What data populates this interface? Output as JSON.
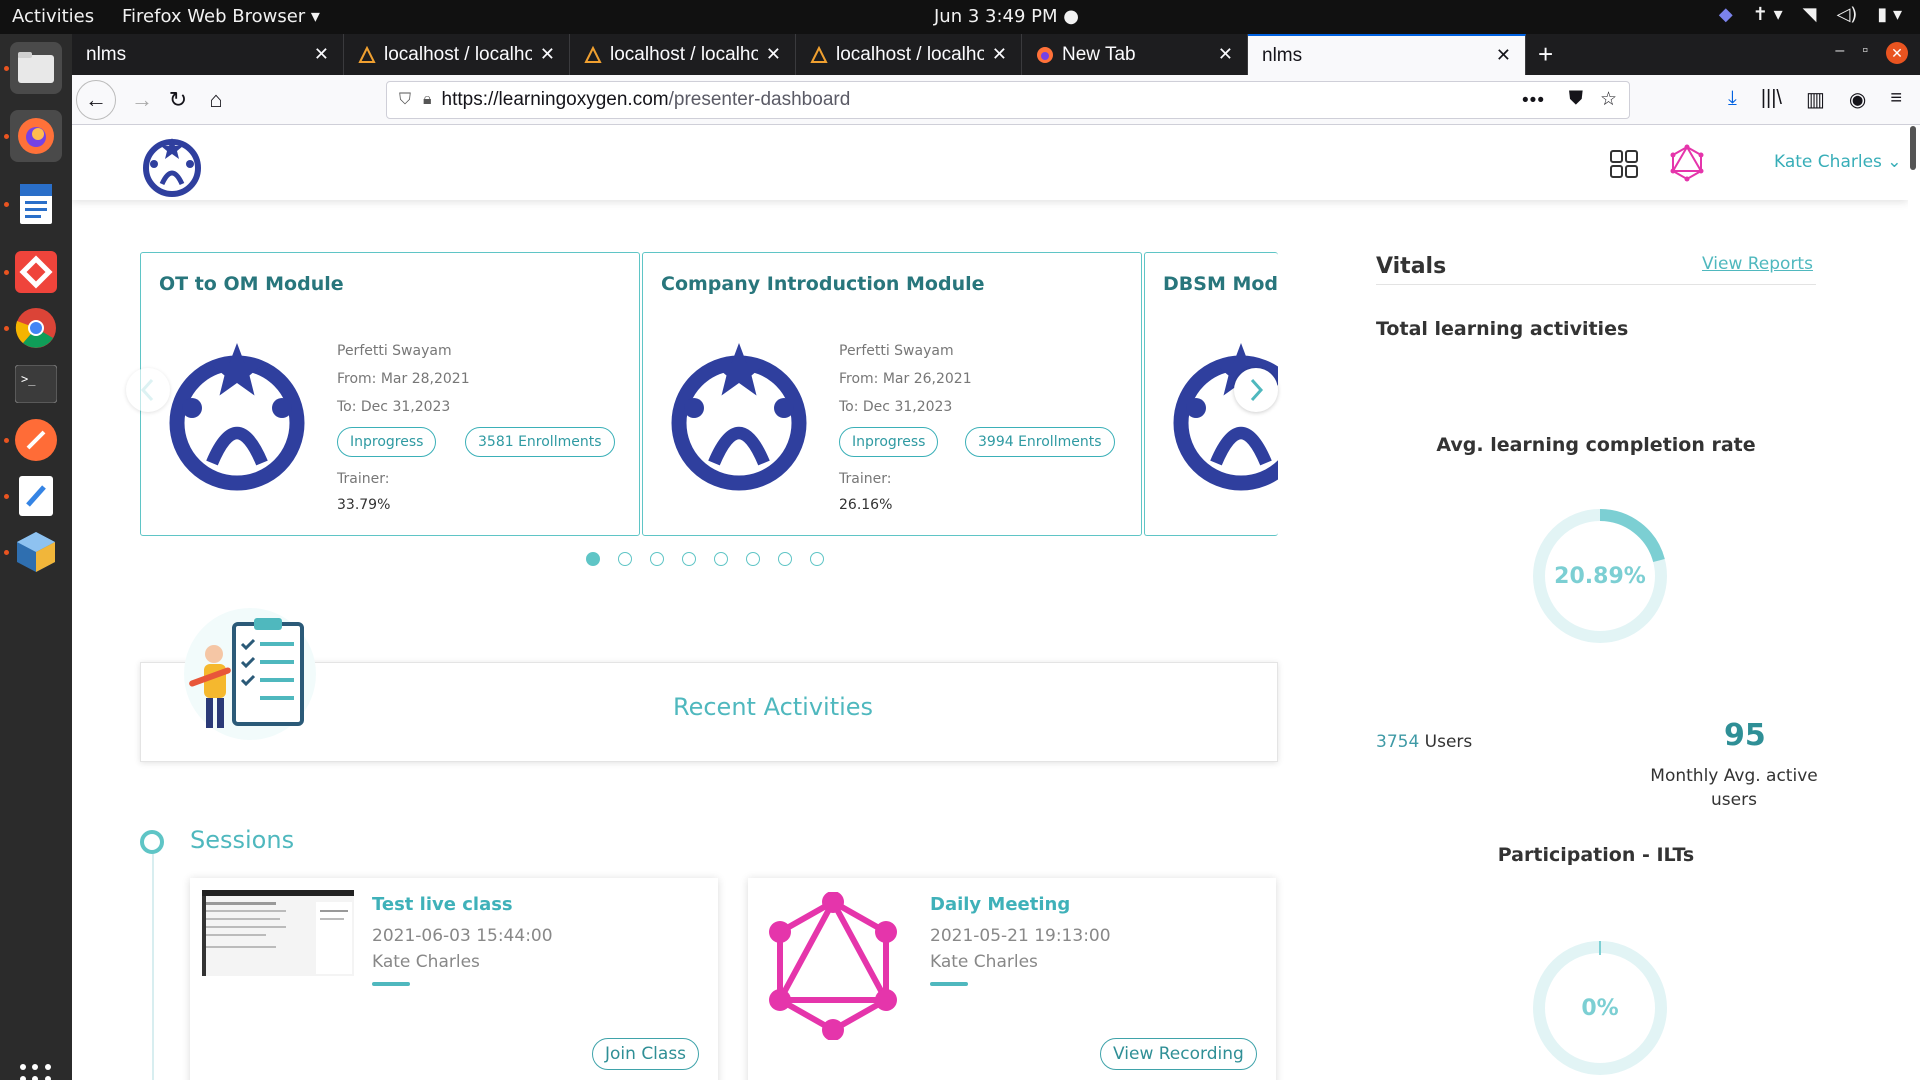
{
  "system": {
    "activities": "Activities",
    "app_menu": "Firefox Web Browser ▾",
    "clock": "Jun 3   3:49 PM  ●"
  },
  "browser": {
    "tabs": [
      {
        "label": "nlms",
        "active": false
      },
      {
        "label": "localhost / localhost / nl",
        "active": false
      },
      {
        "label": "localhost / localhost / nl",
        "active": false
      },
      {
        "label": "localhost / localhost / nl",
        "active": false
      },
      {
        "label": "New Tab",
        "active": false
      },
      {
        "label": "nlms",
        "active": true
      }
    ],
    "url_host": "https://learningoxygen.com",
    "url_path": "/presenter-dashboard"
  },
  "header": {
    "user_name": "Kate Charles ⌄"
  },
  "modules": [
    {
      "title": "OT to OM Module",
      "presenter": "Perfetti Swayam",
      "from": "From: Mar 28,2021",
      "to": "To: Dec 31,2023",
      "status": "Inprogress",
      "enrollments": "3581 Enrollments",
      "trainer_label": "Trainer:",
      "trainer_value": "33.79%"
    },
    {
      "title": "Company Introduction Module",
      "presenter": "Perfetti Swayam",
      "from": "From: Mar 26,2021",
      "to": "To: Dec 31,2023",
      "status": "Inprogress",
      "enrollments": "3994 Enrollments",
      "trainer_label": "Trainer:",
      "trainer_value": "26.16%"
    },
    {
      "title": "DBSM Modu"
    }
  ],
  "carousel": {
    "pages": 8,
    "active": 0
  },
  "recent": {
    "title": "Recent Activities"
  },
  "sessions": {
    "title": "Sessions",
    "items": [
      {
        "title": "Test live class",
        "date": "2021-06-03 15:44:00",
        "host": "Kate Charles",
        "button": "Join Class"
      },
      {
        "title": "Daily Meeting",
        "date": "2021-05-21 19:13:00",
        "host": "Kate Charles",
        "button": "View Recording"
      }
    ]
  },
  "vitals": {
    "title": "Vitals",
    "view_reports": "View Reports",
    "total_learning": "Total learning activities",
    "avg_completion_title": "Avg. learning completion rate",
    "avg_completion_value": "20.89%",
    "avg_completion_fraction": 0.2089,
    "users_count": "3754",
    "users_label": " Users",
    "monthly_value": "95",
    "monthly_label": "Monthly Avg. active users",
    "participation_title": "Participation - ILTs",
    "participation_value": "0%",
    "participation_fraction": 0.0
  },
  "colors": {
    "accent": "#4fb8be",
    "brand_blue": "#2f3f9e",
    "graphql_pink": "#e535ab"
  }
}
